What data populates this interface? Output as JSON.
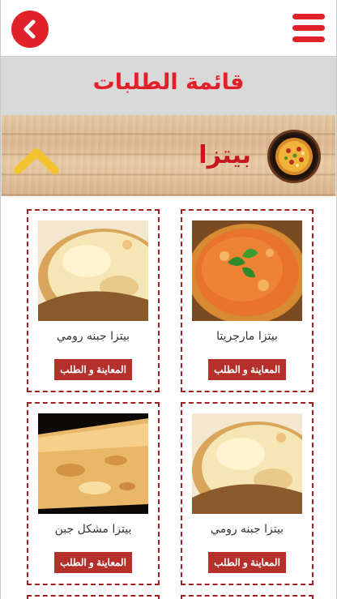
{
  "header": {
    "back_icon": "chevron-left-icon",
    "menu_icon": "hamburger-menu-icon",
    "accent_color": "#e2202a"
  },
  "page": {
    "title": "قائمة الطلبات"
  },
  "category": {
    "label": "بيتزا",
    "thumb_icon": "pizza-icon",
    "toggle_icon": "chevron-up-icon",
    "toggle_color": "#f4c430"
  },
  "products": [
    {
      "name": "بيتزا مارجريتا",
      "button": "المعاينة و الطلب",
      "image": "margherita-pizza-image"
    },
    {
      "name": "بيتزا جبنه رومي",
      "button": "المعاينة و الطلب",
      "image": "cheese-pizza-image"
    },
    {
      "name": "بيتزا جبنه رومي",
      "button": "المعاينة و الطلب",
      "image": "cheese-pizza-image"
    },
    {
      "name": "بيتزا مشكل جبن",
      "button": "المعاينة و الطلب",
      "image": "mixed-cheese-pizza-image"
    }
  ]
}
